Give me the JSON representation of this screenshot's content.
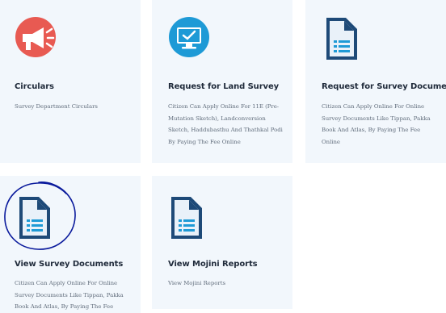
{
  "cards": [
    {
      "title": "Circulars",
      "description": "Survey Department Circulars",
      "icon": "megaphone-icon"
    },
    {
      "title": "Request for Land Survey",
      "description": "Citizen Can Apply Online For 11E (Pre-Mutation Sketch), Landconversion Sketch, Haddubasthu And Thathkal Podi By Paying The Fee Online",
      "icon": "computer-check-icon"
    },
    {
      "title": "Request for Survey Documents",
      "description": "Citizen Can Apply Online For Online Survey Documents Like Tippan, Pakka Book And Atlas, By Paying The Fee Online",
      "icon": "document-icon"
    },
    {
      "title": "View Survey Documents",
      "description": "Citizen Can Apply Online For Online Survey Documents Like Tippan, Pakka Book And Atlas, By Paying The Fee",
      "icon": "document-icon"
    },
    {
      "title": "View Mojini Reports",
      "description": "View Mojini Reports",
      "icon": "document-icon"
    }
  ],
  "colors": {
    "card_bg": "#f2f7fc",
    "megaphone_bg": "#e85a52",
    "computer_bg": "#1e9ad6",
    "document_blue": "#1e4a78",
    "annotation": "#0a1a9c"
  }
}
